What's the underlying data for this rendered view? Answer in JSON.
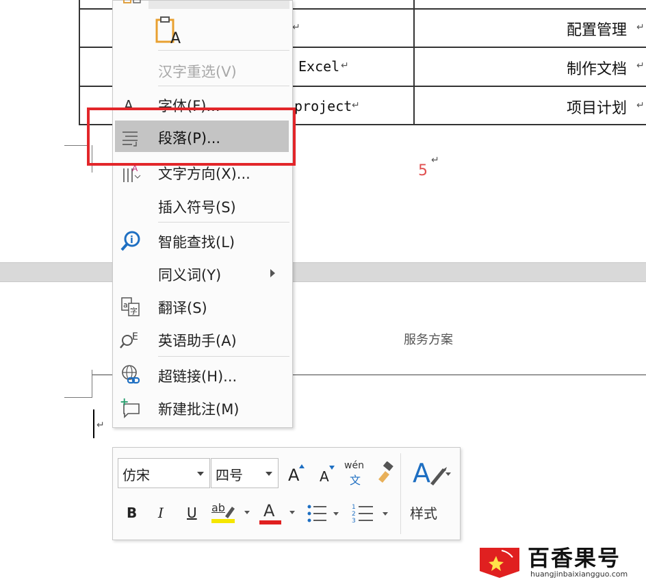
{
  "table": {
    "rows": [
      {
        "left": "",
        "right": "配置管理"
      },
      {
        "left": "Excel",
        "right": "制作文档"
      },
      {
        "left": "project",
        "right": "项目计划"
      }
    ]
  },
  "page_number": "5",
  "next_page_text": "服务方案",
  "context_menu": {
    "items": [
      {
        "label": "汉字重选(V)",
        "enabled": false
      },
      {
        "label": "字体(F)...",
        "enabled": true
      },
      {
        "label": "段落(P)...",
        "enabled": true,
        "highlighted": true
      },
      {
        "label": "文字方向(X)...",
        "enabled": true
      },
      {
        "label": "插入符号(S)",
        "enabled": true
      },
      {
        "label": "智能查找(L)",
        "enabled": true
      },
      {
        "label": "同义词(Y)",
        "enabled": true,
        "submenu": true
      },
      {
        "label": "翻译(S)",
        "enabled": true
      },
      {
        "label": "英语助手(A)",
        "enabled": true
      },
      {
        "label": "超链接(H)...",
        "enabled": true
      },
      {
        "label": "新建批注(M)",
        "enabled": true
      }
    ]
  },
  "mini_toolbar": {
    "font_name": "仿宋",
    "font_size": "四号",
    "grow_font": "A",
    "shrink_font": "A",
    "phonetic_top": "wén",
    "phonetic_bottom": "文",
    "bold": "B",
    "italic": "I",
    "underline": "U",
    "highlight": "ab",
    "font_color": "A",
    "styles_label": "样式",
    "highlight_color": "#f5e600",
    "font_color_bar": "#e02020"
  },
  "watermark": {
    "title": "百香果号",
    "url": "huangjinbaixiangguo.com",
    "logo_color": "#e02020"
  },
  "colors": {
    "annotation_red": "#e2262a",
    "menu_highlight": "#c4c4c4",
    "page_number_color": "#e05050"
  }
}
